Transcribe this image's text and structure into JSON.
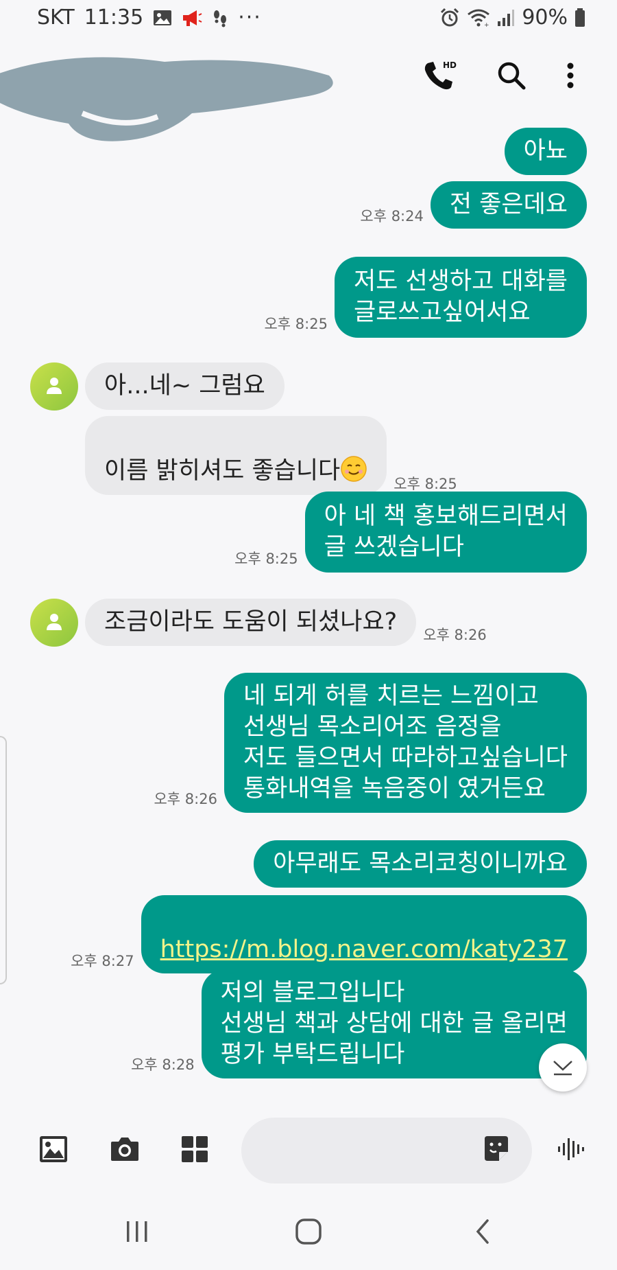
{
  "status_bar": {
    "carrier": "SKT",
    "time": "11:35",
    "dots": "···",
    "battery": "90%"
  },
  "header": {
    "contact_name": ""
  },
  "messages": [
    {
      "side": "out",
      "text": "아뇨",
      "time": ""
    },
    {
      "side": "out",
      "text": "전 좋은데요",
      "time": "오후 8:24"
    },
    {
      "side": "out",
      "text": "저도 선생하고 대화를\n글로쓰고싶어서요",
      "time": "오후 8:25"
    },
    {
      "side": "in",
      "text": "아...네~ 그럼요",
      "time": ""
    },
    {
      "side": "in",
      "text": "이름 밝히셔도 좋습니다",
      "time": "오후 8:25"
    },
    {
      "side": "out",
      "text": "아 네 책 홍보해드리면서\n글 쓰겠습니다",
      "time": "오후 8:25"
    },
    {
      "side": "in",
      "text": "조금이라도 도움이 되셨나요?",
      "time": "오후 8:26"
    },
    {
      "side": "out",
      "text": "네 되게 허를 치르는 느낌이고\n선생님 목소리어조 음정을\n저도 들으면서  따라하고싶습니다\n통화내역을 녹음중이 였거든요",
      "time": "오후 8:26"
    },
    {
      "side": "out",
      "text": "아무래도 목소리코칭이니까요",
      "time": ""
    },
    {
      "side": "out",
      "text": "https://m.blog.naver.com/katy237",
      "time": "오후 8:27"
    },
    {
      "side": "out",
      "text": "저의 블로그입니다\n선생님 책과 상담에 대한 글 올리면\n평가 부탁드립니다",
      "time": "오후 8:28"
    }
  ],
  "composer": {
    "placeholder": ""
  },
  "colors": {
    "outgoing_bubble": "#00998a",
    "incoming_bubble": "#e9e9eb",
    "link": "#f3f38a",
    "notification_red": "#e0231c"
  },
  "icons": {
    "status": [
      "gallery-icon",
      "megaphone-icon",
      "footprints-icon",
      "alarm-icon",
      "wifi-icon",
      "signal-icon",
      "battery-icon"
    ],
    "header": [
      "hd-call-icon",
      "search-icon",
      "more-vert-icon"
    ],
    "composer": [
      "image-icon",
      "camera-icon",
      "apps-grid-icon",
      "sticker-icon",
      "voice-icon"
    ],
    "nav": [
      "recent-apps-icon",
      "home-icon",
      "back-icon"
    ]
  }
}
